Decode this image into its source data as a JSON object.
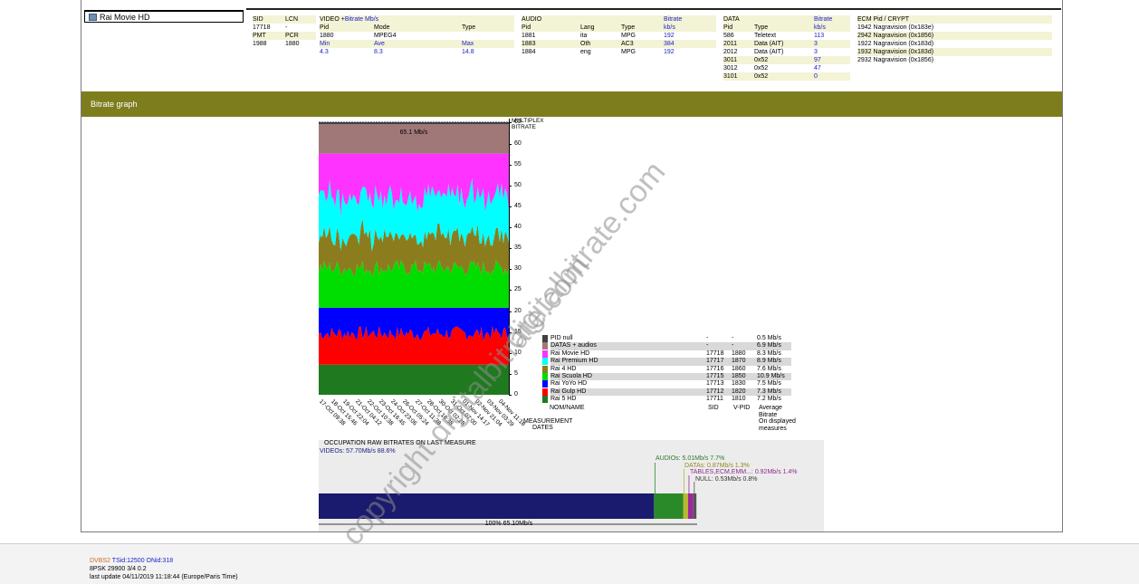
{
  "channel": {
    "name": "Rai Movie HD"
  },
  "sid_table": {
    "headers": [
      "SID",
      "LCN"
    ],
    "rows": [
      [
        "17718",
        "-"
      ],
      [
        "PMT",
        "PCR"
      ],
      [
        "1988",
        "1880"
      ]
    ]
  },
  "video": {
    "title_a": "VIDEO + ",
    "title_b": "Bitrate Mb/s",
    "headers": [
      "Pid",
      "Mode",
      "Type"
    ],
    "row": [
      "1880",
      "MPEG4",
      ""
    ],
    "stat_headers": [
      "Min",
      "Ave",
      "Max"
    ],
    "stats": [
      "4.3",
      "8.3",
      "14.8"
    ]
  },
  "audio": {
    "title": "AUDIO",
    "bitrate_label": "Bitrate",
    "headers": [
      "Pid",
      "Lang",
      "Type",
      "kb/s"
    ],
    "rows": [
      [
        "1881",
        "ita",
        "MPG",
        "192"
      ],
      [
        "1883",
        "Oth",
        "AC3",
        "384"
      ],
      [
        "1884",
        "eng",
        "MPG",
        "192"
      ]
    ]
  },
  "data": {
    "title": "DATA",
    "bitrate_label": "Bitrate",
    "headers": [
      "Pid",
      "Type",
      "kb/s"
    ],
    "rows": [
      [
        "586",
        "Teletext",
        "113"
      ],
      [
        "2011",
        "Data (AIT)",
        "3"
      ],
      [
        "2012",
        "Data (AIT)",
        "3"
      ],
      [
        "3011",
        "0x52",
        "97"
      ],
      [
        "3012",
        "0x52",
        "47"
      ],
      [
        "3101",
        "0x52",
        "0"
      ]
    ]
  },
  "ecm": {
    "title": "ECM Pid / CRYPT",
    "rows": [
      "1942 Nagravision (0x183e)",
      "2942 Nagravision (0x1856)",
      "1922 Nagravision (0x183d)",
      "1932 Nagravision (0x183d)",
      "2932 Nagravision (0x1856)"
    ]
  },
  "section": {
    "title": "Bitrate graph"
  },
  "graph": {
    "multiplex_label_1": "MULTIPLEX",
    "multiplex_label_2": "BITRATE",
    "top_value": "65.1 Mb/s",
    "measurement_label_1": "MEASUREMENT",
    "measurement_label_2": "DATES",
    "dates": [
      "17-Oct 09:38",
      "18-Oct 15:46",
      "19-Oct 22:04",
      "21-Oct 04:12",
      "22-Oct 10:38",
      "23-Oct 16:45",
      "24-Oct 23:06",
      "26-Oct 05:24",
      "27-Oct 11:38",
      "28-Oct 18:38",
      "30-Oct 02:28",
      "31-Oct 07:00",
      "01-Nov 14:17",
      "02-Nov 21:04",
      "03-Nov 03:29",
      "04-Nov 11:18"
    ]
  },
  "chart_data": {
    "type": "area",
    "ylabel": "MULTIPLEX BITRATE",
    "ylim": [
      0,
      65
    ],
    "yticks": [
      0,
      5,
      10,
      15,
      20,
      25,
      30,
      35,
      40,
      45,
      50,
      55,
      60,
      65
    ],
    "series": [
      {
        "name": "Rai 5 HD",
        "color": "#1f7a1f",
        "average_mbps": 7.2
      },
      {
        "name": "Rai Gulp HD",
        "color": "#ff0000",
        "average_mbps": 7.3
      },
      {
        "name": "Rai YoYo HD",
        "color": "#0000ff",
        "average_mbps": 7.5
      },
      {
        "name": "Rai Scuola HD",
        "color": "#00dd00",
        "average_mbps": 10.9
      },
      {
        "name": "Rai 4 HD",
        "color": "#8b7d1e",
        "average_mbps": 7.6
      },
      {
        "name": "Rai Premium HD",
        "color": "#00ffff",
        "average_mbps": 8.9
      },
      {
        "name": "Rai Movie HD",
        "color": "#ff33ff",
        "average_mbps": 8.3
      },
      {
        "name": "DATAS + audios",
        "color": "#a07878",
        "average_mbps": 6.9
      },
      {
        "name": "PID null",
        "color": "#404040",
        "average_mbps": 0.5
      }
    ]
  },
  "legend": {
    "rows": [
      {
        "name": "PID null",
        "color": "#404040",
        "sid": "-",
        "vpid": "-",
        "avg": "0.5 Mb/s"
      },
      {
        "name": "DATAS + audios",
        "color": "#a07878",
        "sid": "-",
        "vpid": "-",
        "avg": "6.9 Mb/s"
      },
      {
        "name": "Rai Movie HD",
        "color": "#ff33ff",
        "sid": "17718",
        "vpid": "1880",
        "avg": "8.3 Mb/s"
      },
      {
        "name": "Rai Premium HD",
        "color": "#00ffff",
        "sid": "17717",
        "vpid": "1870",
        "avg": "8.9 Mb/s"
      },
      {
        "name": "Rai 4 HD",
        "color": "#8b7d1e",
        "sid": "17716",
        "vpid": "1860",
        "avg": "7.6 Mb/s"
      },
      {
        "name": "Rai Scuola HD",
        "color": "#00dd00",
        "sid": "17715",
        "vpid": "1850",
        "avg": "10.9 Mb/s"
      },
      {
        "name": "Rai YoYo HD",
        "color": "#0000ff",
        "sid": "17713",
        "vpid": "1830",
        "avg": "7.5 Mb/s"
      },
      {
        "name": "Rai Gulp HD",
        "color": "#ff0000",
        "sid": "17712",
        "vpid": "1820",
        "avg": "7.3 Mb/s"
      },
      {
        "name": "Rai 5 HD",
        "color": "#1f7a1f",
        "sid": "17711",
        "vpid": "1810",
        "avg": "7.2 Mb/s"
      }
    ],
    "foot": [
      "NOM/NAME",
      "SID",
      "V-PID",
      "Average",
      "Bitrate",
      "On displayed",
      "measures"
    ]
  },
  "occupation": {
    "title": "OCCUPATION RAW BITRATES ON LAST MEASURE",
    "videos": "VIDEOs: 57.70Mb/s  88.6%",
    "audios": "AUDIOs: 5.01Mb/s  7.7%",
    "datas": "DATAs: 0.87Mb/s  1.3%",
    "tables": "TABLES,ECM,EMM...: 0.92Mb/s  1.4%",
    "null": "NULL: 0.53Mb/s  0.8%",
    "total": "100%  65.10Mb/s",
    "fractions": [
      0.886,
      0.077,
      0.013,
      0.014,
      0.008
    ]
  },
  "footer": {
    "dvbs2": "DVBS2",
    "tsid": " TSid:12500 ONid:318",
    "modulation": "8PSK 29900 3/4 0.2",
    "last_update": "last update 04/11/2019 11:18:44 (Europe/Paris Time)"
  },
  "watermark": {
    "line1": "digitalbitrate.com",
    "line2": "copyright digitalbitrate.com"
  }
}
